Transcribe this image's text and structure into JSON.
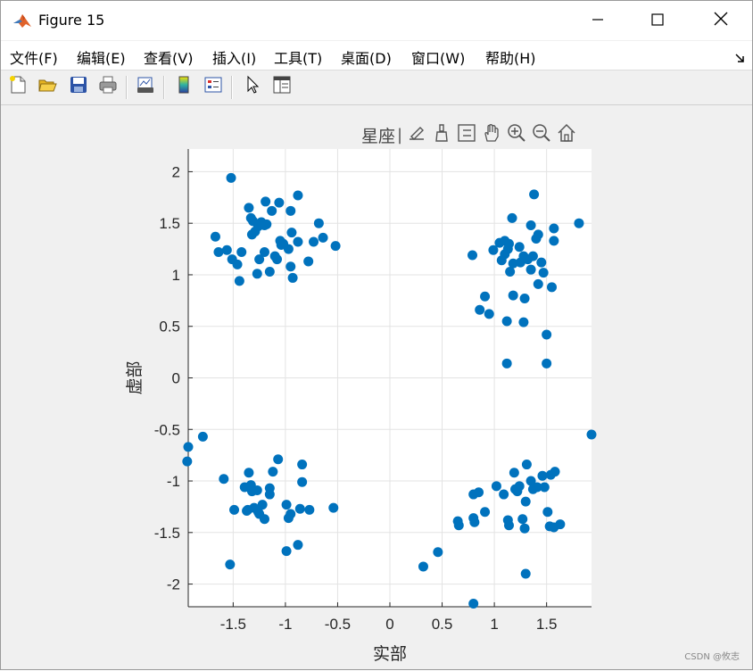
{
  "window": {
    "title": "Figure 15",
    "icon": "matlab-logo-icon",
    "controls": [
      "minimize-icon",
      "maximize-icon",
      "close-icon"
    ]
  },
  "menubar": {
    "items": [
      "文件(F)",
      "编辑(E)",
      "查看(V)",
      "插入(I)",
      "工具(T)",
      "桌面(D)",
      "窗口(W)",
      "帮助(H)"
    ],
    "dock_icon": "dock-arrow-icon"
  },
  "toolbar": {
    "icons": [
      "new-figure-icon",
      "open-file-icon",
      "save-icon",
      "print-icon",
      "link-plot-icon",
      "colorbar-icon",
      "legend-icon",
      "pointer-icon",
      "property-inspector-icon"
    ]
  },
  "axes_toolbar": {
    "label": "星座",
    "icons": [
      "export-icon",
      "brush-icon",
      "data-tips-icon",
      "pan-icon",
      "zoom-in-icon",
      "zoom-out-icon",
      "home-icon"
    ]
  },
  "watermark": "CSDN @攸志",
  "chart_data": {
    "type": "scatter",
    "title": "",
    "xlabel": "实部",
    "ylabel": "虚部",
    "xlim": [
      -1.93,
      1.93
    ],
    "ylim": [
      -2.22,
      2.22
    ],
    "xticks": [
      -1.5,
      -1,
      -0.5,
      0,
      0.5,
      1,
      1.5
    ],
    "xtick_labels": [
      "-1.5",
      "-1",
      "-0.5",
      "0",
      "0.5",
      "1",
      "1.5"
    ],
    "yticks": [
      2,
      1.5,
      1,
      0.5,
      0,
      -0.5,
      -1,
      -1.5,
      -2
    ],
    "ytick_labels": [
      "2",
      "1.5",
      "1",
      "0.5",
      "0",
      "-0.5",
      "-1",
      "-1.5",
      "-2"
    ],
    "grid": true,
    "marker_color": "#0072BD",
    "series": [
      {
        "points": [
          [
            -1.52,
            1.94
          ],
          [
            -1.42,
            1.22
          ],
          [
            -1.33,
            1.55
          ],
          [
            -1.18,
            1.49
          ],
          [
            -1.26,
            1.47
          ],
          [
            -1.29,
            1.42
          ],
          [
            -1.19,
            1.71
          ],
          [
            -1.13,
            1.62
          ],
          [
            -1.35,
            1.65
          ],
          [
            -1.23,
            1.51
          ],
          [
            -1.31,
            1.52
          ],
          [
            -1.05,
            1.33
          ],
          [
            -1.02,
            1.3
          ],
          [
            -1.04,
            1.29
          ],
          [
            -0.95,
            1.62
          ],
          [
            -0.94,
            1.41
          ],
          [
            -0.88,
            1.77
          ],
          [
            -0.88,
            1.32
          ],
          [
            -0.95,
            1.08
          ],
          [
            -0.93,
            0.97
          ],
          [
            -0.78,
            1.13
          ],
          [
            -0.73,
            1.32
          ],
          [
            -0.68,
            1.5
          ],
          [
            -0.64,
            1.36
          ],
          [
            -0.52,
            1.28
          ],
          [
            -1.56,
            1.24
          ],
          [
            -1.51,
            1.15
          ],
          [
            -1.46,
            1.1
          ],
          [
            -1.44,
            0.94
          ],
          [
            -1.27,
            1.01
          ],
          [
            -1.25,
            1.15
          ],
          [
            -1.2,
            1.22
          ],
          [
            -1.15,
            1.03
          ],
          [
            -1.08,
            1.15
          ],
          [
            -1.06,
            1.7
          ],
          [
            -1.67,
            1.37
          ],
          [
            -1.64,
            1.22
          ],
          [
            -1.2,
            1.48
          ],
          [
            -1.32,
            1.39
          ],
          [
            -1.1,
            1.18
          ],
          [
            -0.97,
            1.25
          ]
        ]
      },
      {
        "points": [
          [
            1.38,
            1.78
          ],
          [
            1.81,
            1.5
          ],
          [
            1.17,
            1.55
          ],
          [
            1.35,
            1.48
          ],
          [
            1.4,
            1.35
          ],
          [
            1.57,
            1.45
          ],
          [
            1.1,
            1.33
          ],
          [
            1.14,
            1.3
          ],
          [
            1.42,
            1.39
          ],
          [
            1.57,
            1.33
          ],
          [
            0.99,
            1.24
          ],
          [
            1.05,
            1.31
          ],
          [
            1.1,
            1.2
          ],
          [
            1.13,
            1.25
          ],
          [
            1.18,
            1.11
          ],
          [
            1.25,
            1.12
          ],
          [
            1.32,
            1.15
          ],
          [
            1.37,
            1.18
          ],
          [
            1.45,
            1.12
          ],
          [
            0.79,
            1.19
          ],
          [
            1.15,
            1.03
          ],
          [
            1.42,
            0.91
          ],
          [
            1.55,
            0.88
          ],
          [
            1.18,
            0.8
          ],
          [
            1.29,
            0.77
          ],
          [
            0.91,
            0.79
          ],
          [
            0.86,
            0.66
          ],
          [
            0.95,
            0.62
          ],
          [
            1.12,
            0.55
          ],
          [
            1.28,
            0.54
          ],
          [
            1.5,
            0.42
          ],
          [
            1.12,
            0.14
          ],
          [
            1.5,
            0.14
          ],
          [
            1.35,
            1.05
          ],
          [
            1.24,
            1.27
          ],
          [
            1.47,
            1.02
          ],
          [
            1.28,
            1.18
          ],
          [
            1.07,
            1.14
          ]
        ]
      },
      {
        "points": [
          [
            -1.93,
            -0.67
          ],
          [
            -1.94,
            -0.81
          ],
          [
            -1.79,
            -0.57
          ],
          [
            -1.59,
            -0.98
          ],
          [
            -1.53,
            -1.81
          ],
          [
            -1.49,
            -1.28
          ],
          [
            -1.39,
            -1.06
          ],
          [
            -1.35,
            -0.92
          ],
          [
            -1.33,
            -1.04
          ],
          [
            -1.37,
            -1.29
          ],
          [
            -1.3,
            -1.26
          ],
          [
            -1.27,
            -1.09
          ],
          [
            -1.25,
            -1.32
          ],
          [
            -1.22,
            -1.23
          ],
          [
            -1.2,
            -1.37
          ],
          [
            -1.15,
            -1.07
          ],
          [
            -1.15,
            -1.13
          ],
          [
            -1.12,
            -0.91
          ],
          [
            -1.07,
            -0.79
          ],
          [
            -0.99,
            -1.23
          ],
          [
            -0.97,
            -1.36
          ],
          [
            -0.95,
            -1.32
          ],
          [
            -0.99,
            -1.68
          ],
          [
            -0.88,
            -1.62
          ],
          [
            -0.86,
            -1.27
          ],
          [
            -0.84,
            -1.01
          ],
          [
            -0.84,
            -0.84
          ],
          [
            -0.77,
            -1.28
          ],
          [
            -0.54,
            -1.26
          ],
          [
            -1.36,
            -1.28
          ],
          [
            -1.26,
            -1.3
          ],
          [
            -1.32,
            -1.1
          ]
        ]
      },
      {
        "points": [
          [
            0.8,
            -2.19
          ],
          [
            0.32,
            -1.83
          ],
          [
            0.46,
            -1.69
          ],
          [
            0.65,
            -1.39
          ],
          [
            0.66,
            -1.43
          ],
          [
            0.8,
            -1.36
          ],
          [
            0.81,
            -1.4
          ],
          [
            0.8,
            -1.13
          ],
          [
            0.85,
            -1.11
          ],
          [
            0.91,
            -1.3
          ],
          [
            1.02,
            -1.05
          ],
          [
            1.09,
            -1.13
          ],
          [
            1.13,
            -1.38
          ],
          [
            1.14,
            -1.43
          ],
          [
            1.19,
            -0.92
          ],
          [
            1.2,
            -1.08
          ],
          [
            1.22,
            -1.1
          ],
          [
            1.27,
            -1.37
          ],
          [
            1.29,
            -1.46
          ],
          [
            1.3,
            -1.2
          ],
          [
            1.31,
            -0.84
          ],
          [
            1.3,
            -1.9
          ],
          [
            1.35,
            -1.0
          ],
          [
            1.37,
            -1.08
          ],
          [
            1.41,
            -1.06
          ],
          [
            1.48,
            -1.06
          ],
          [
            1.51,
            -1.3
          ],
          [
            1.53,
            -1.44
          ],
          [
            1.54,
            -0.94
          ],
          [
            1.58,
            -0.91
          ],
          [
            1.57,
            -1.45
          ],
          [
            1.63,
            -1.42
          ],
          [
            1.93,
            -0.55
          ],
          [
            1.24,
            -1.05
          ],
          [
            1.46,
            -0.95
          ]
        ]
      }
    ]
  }
}
